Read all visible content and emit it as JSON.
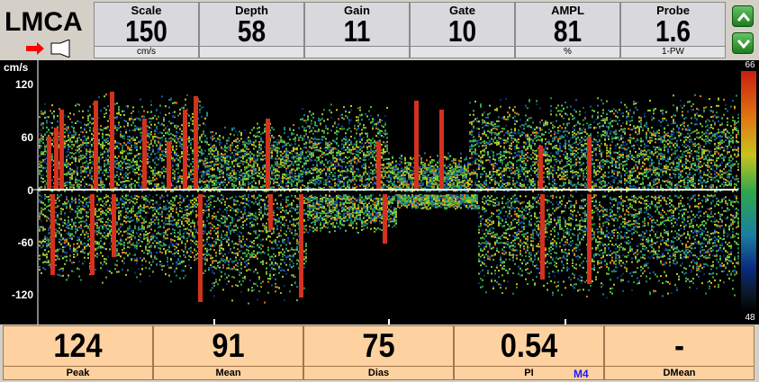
{
  "vessel": {
    "name": "LMCA"
  },
  "params": [
    {
      "label": "Scale",
      "value": "150",
      "unit": "cm/s"
    },
    {
      "label": "Depth",
      "value": "58",
      "unit": ""
    },
    {
      "label": "Gain",
      "value": "11",
      "unit": ""
    },
    {
      "label": "Gate",
      "value": "10",
      "unit": ""
    },
    {
      "label": "AMPL",
      "value": "81",
      "unit": "%"
    },
    {
      "label": "Probe",
      "value": "1.6",
      "unit": "1-PW"
    }
  ],
  "spectrum": {
    "y_unit": "cm/s",
    "y_ticks": [
      "120",
      "60",
      "0",
      "-60",
      "-120"
    ],
    "colorbar_max": "66",
    "colorbar_min": "48"
  },
  "measurements": [
    {
      "label": "Peak",
      "value": "124"
    },
    {
      "label": "Mean",
      "value": "91"
    },
    {
      "label": "Dias",
      "value": "75"
    },
    {
      "label": "PI",
      "value": "0.54"
    },
    {
      "label": "DMean",
      "value": "-"
    }
  ],
  "mode_tag": "M4",
  "colors": {
    "arrow": "#ff0000",
    "panel_bg": "#d9d9dd",
    "measure_bg": "#fdd1a0",
    "nav_button": "#2a9a2a"
  }
}
